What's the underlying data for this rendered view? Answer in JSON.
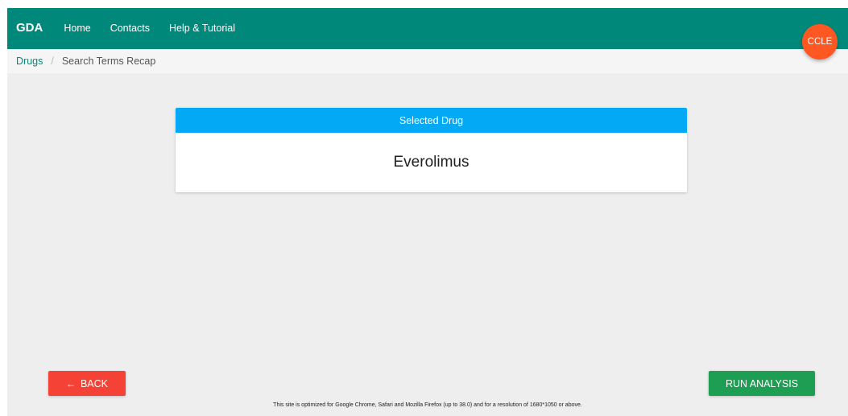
{
  "navbar": {
    "brand": "GDA",
    "links": [
      "Home",
      "Contacts",
      "Help & Tutorial"
    ]
  },
  "fab": {
    "label": "CCLE",
    "color": "#ff5722"
  },
  "breadcrumb": {
    "root": "Drugs",
    "current": "Search Terms Recap"
  },
  "card": {
    "header": "Selected Drug",
    "value": "Everolimus"
  },
  "buttons": {
    "back_label": "BACK",
    "back_icon": "left-arrow-icon",
    "run_label": "RUN ANALYSIS"
  },
  "footer": {
    "note": "This site is optimized for Google Chrome, Safari and Mozilla Firefox (up to 38.0) and for a resolution of 1680*1050 or above."
  },
  "colors": {
    "navbar": "#00897b",
    "card_header": "#03a9f4",
    "back_button": "#f44336",
    "run_button": "#1e9e52"
  }
}
